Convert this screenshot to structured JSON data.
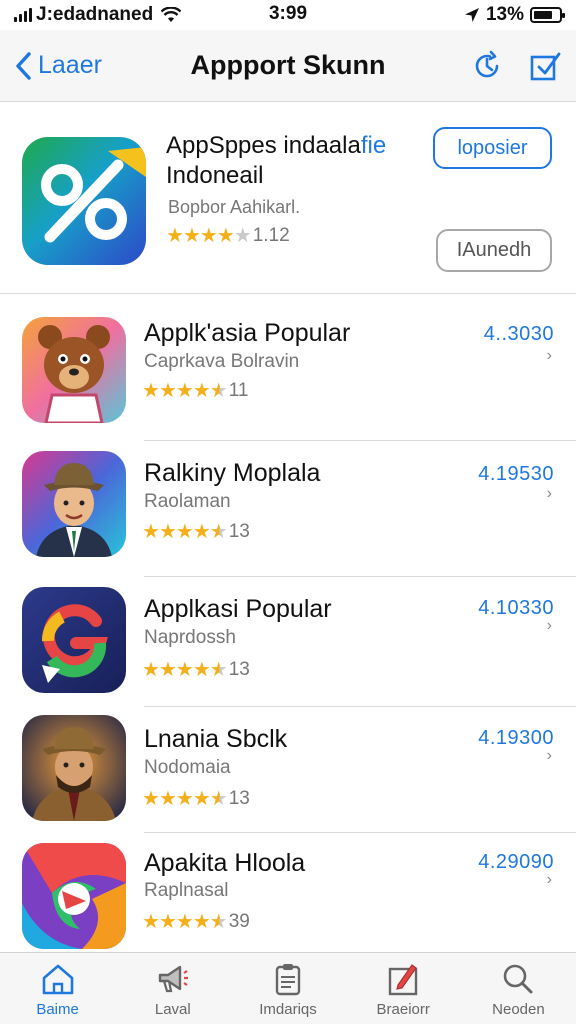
{
  "status_bar": {
    "carrier": "J:edadnaned",
    "time": "3:99",
    "battery": "13%"
  },
  "nav": {
    "back_label": "Laaer",
    "title": "Appport Skunn"
  },
  "featured": {
    "title_line1": "AppSppes indaala",
    "title_accent": "fie",
    "title_line2": "Indoneail",
    "subtitle": "Bopbor Aahikarl.",
    "rating_count": "1.12",
    "open_button": "loposier",
    "launch_button": "IAunedh"
  },
  "apps": [
    {
      "name": "Applk'asia Popular",
      "subtitle": "Caprkava Bolravin",
      "rating_count": "11",
      "price": "4..3030",
      "icon": "bear-icon"
    },
    {
      "name": "Ralkiny Moplala",
      "subtitle": "Raolaman",
      "rating_count": "13",
      "price": "4.19530",
      "icon": "man-in-hat-icon"
    },
    {
      "name": "Applkasi Popular",
      "subtitle": "Naprdossh",
      "rating_count": "13",
      "price": "4.10330",
      "icon": "g-logo-icon"
    },
    {
      "name": "Lnania Sbclk",
      "subtitle": "Nodomaia",
      "rating_count": "13",
      "price": "4.19300",
      "icon": "detective-icon"
    },
    {
      "name": "Apakita Hloola",
      "subtitle": "Raplnasal",
      "rating_count": "39",
      "price": "4.29090",
      "icon": "swirl-icon"
    }
  ],
  "tabs": [
    {
      "label": "Baime",
      "icon": "home-icon",
      "active": true
    },
    {
      "label": "Laval",
      "icon": "megaphone-icon",
      "active": false
    },
    {
      "label": "Imdariqs",
      "icon": "clipboard-icon",
      "active": false
    },
    {
      "label": "Braeiorr",
      "icon": "pencil-box-icon",
      "active": false
    },
    {
      "label": "Neoden",
      "icon": "search-icon",
      "active": false
    }
  ],
  "colors": {
    "accent": "#1f78e0",
    "star": "#f3b01b"
  }
}
